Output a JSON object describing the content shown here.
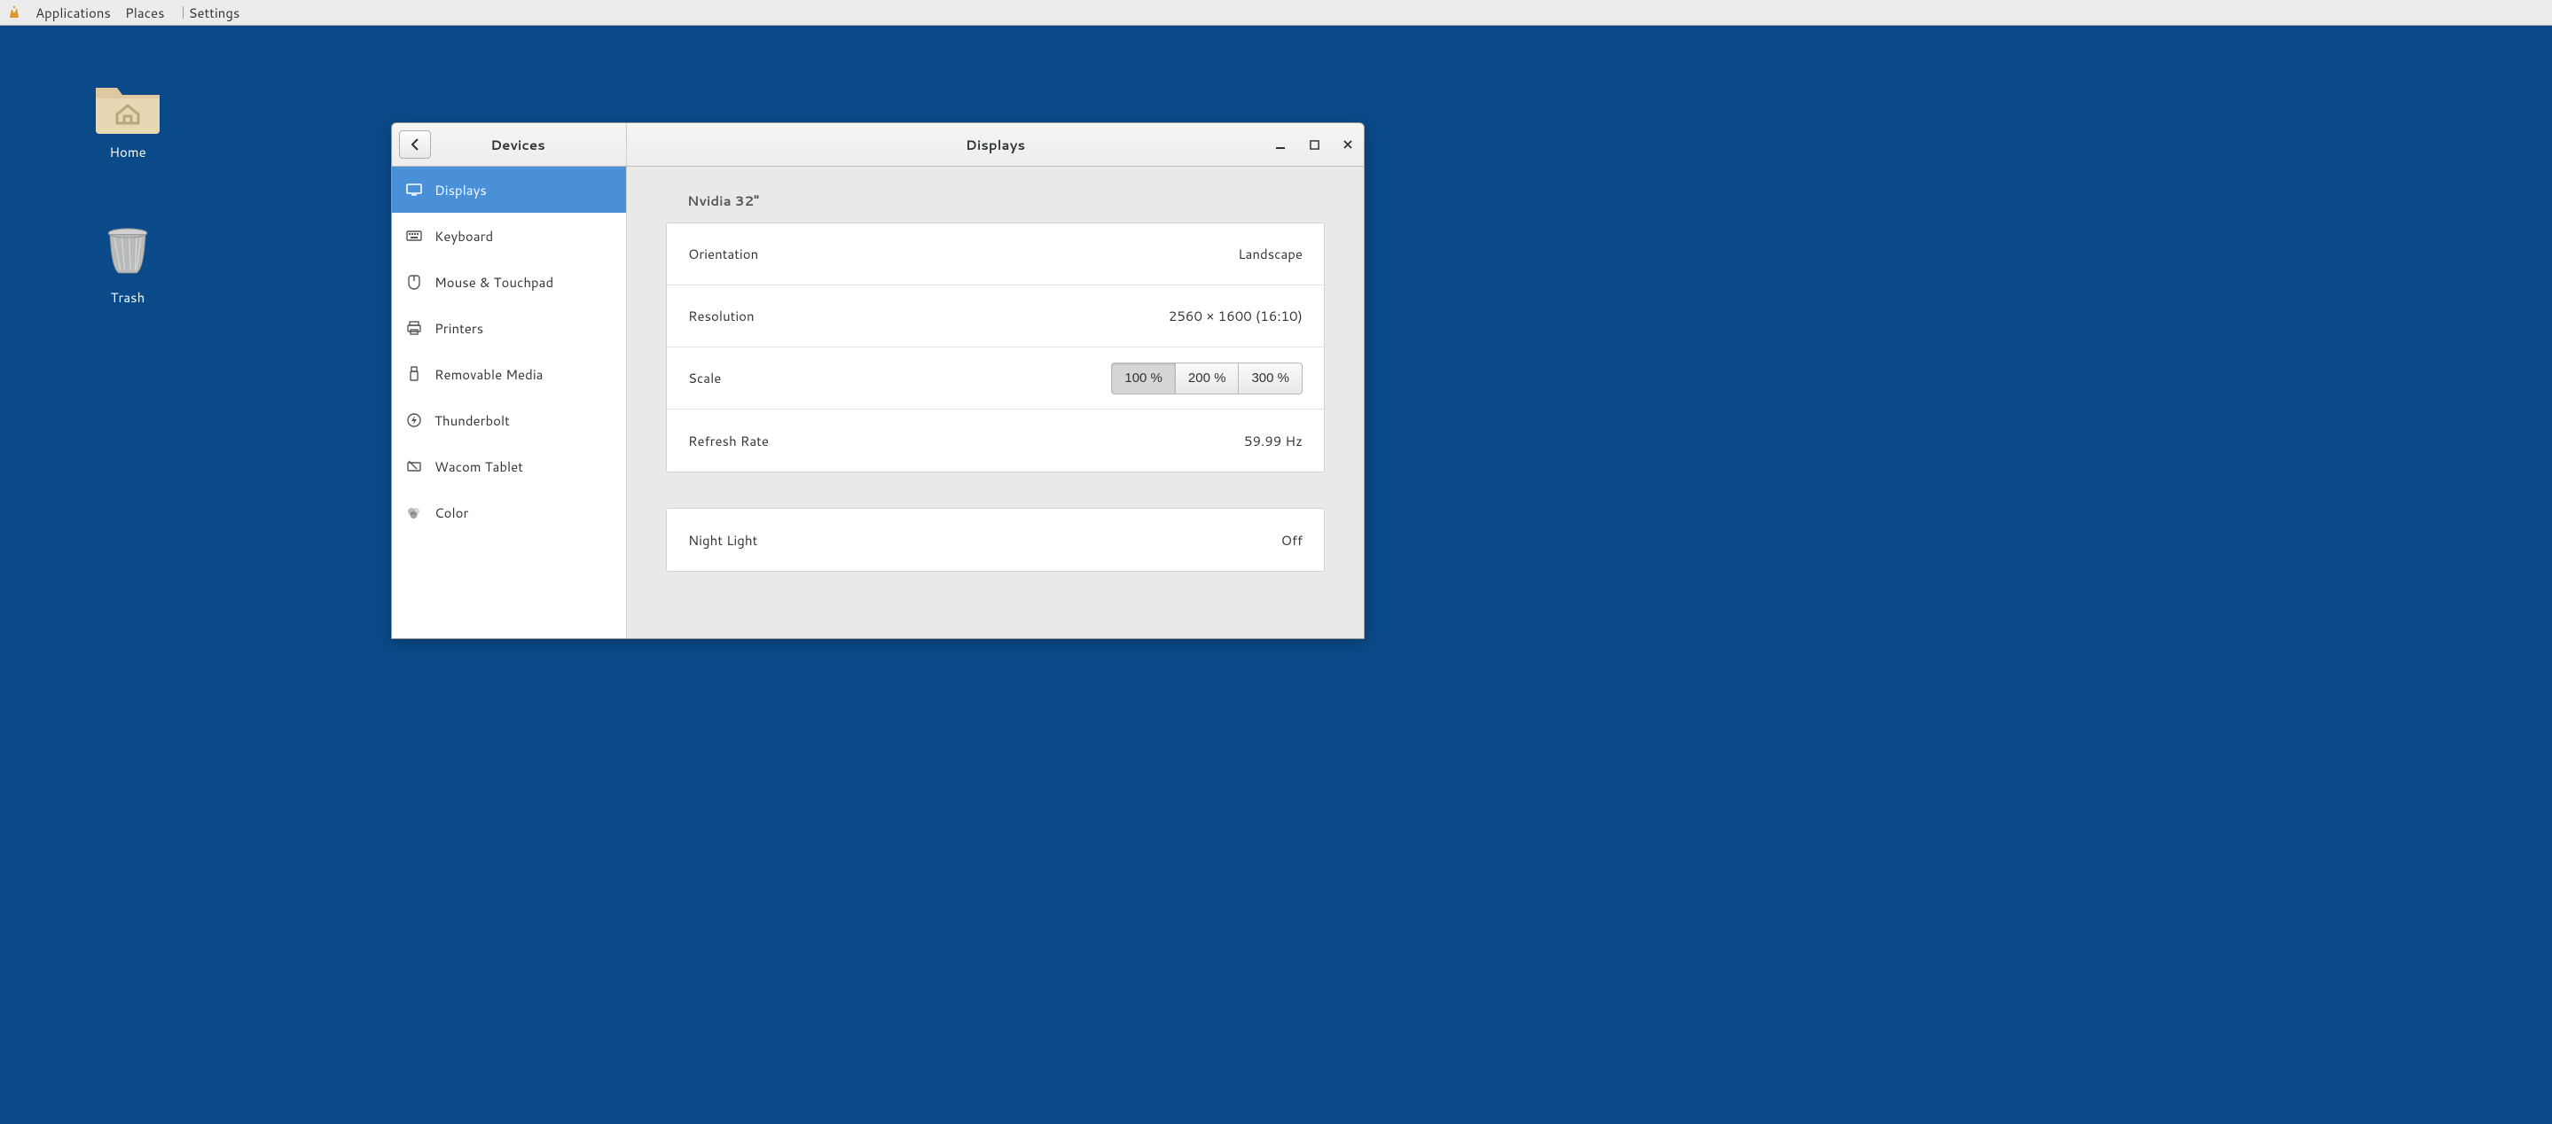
{
  "topbar": {
    "applications": "Applications",
    "places": "Places",
    "settings": "Settings"
  },
  "desktop": {
    "home": "Home",
    "trash": "Trash"
  },
  "window": {
    "left_title": "Devices",
    "right_title": "Displays"
  },
  "sidebar": {
    "items": [
      {
        "id": "displays",
        "label": "Displays",
        "icon": "display-icon",
        "active": true
      },
      {
        "id": "keyboard",
        "label": "Keyboard",
        "icon": "keyboard-icon",
        "active": false
      },
      {
        "id": "mouse",
        "label": "Mouse & Touchpad",
        "icon": "mouse-icon",
        "active": false
      },
      {
        "id": "printers",
        "label": "Printers",
        "icon": "printer-icon",
        "active": false
      },
      {
        "id": "removable",
        "label": "Removable Media",
        "icon": "usb-icon",
        "active": false
      },
      {
        "id": "thunderbolt",
        "label": "Thunderbolt",
        "icon": "thunderbolt-icon",
        "active": false
      },
      {
        "id": "wacom",
        "label": "Wacom Tablet",
        "icon": "tablet-icon",
        "active": false
      },
      {
        "id": "color",
        "label": "Color",
        "icon": "color-icon",
        "active": false
      }
    ]
  },
  "main": {
    "monitor_title": "Nvidia 32\"",
    "orientation": {
      "label": "Orientation",
      "value": "Landscape"
    },
    "resolution": {
      "label": "Resolution",
      "value": "2560 × 1600 (16:10)"
    },
    "scale": {
      "label": "Scale",
      "options": [
        "100 %",
        "200 %",
        "300 %"
      ],
      "active": 0
    },
    "refresh": {
      "label": "Refresh Rate",
      "value": "59.99 Hz"
    },
    "nightlight": {
      "label": "Night Light",
      "value": "Off"
    }
  }
}
